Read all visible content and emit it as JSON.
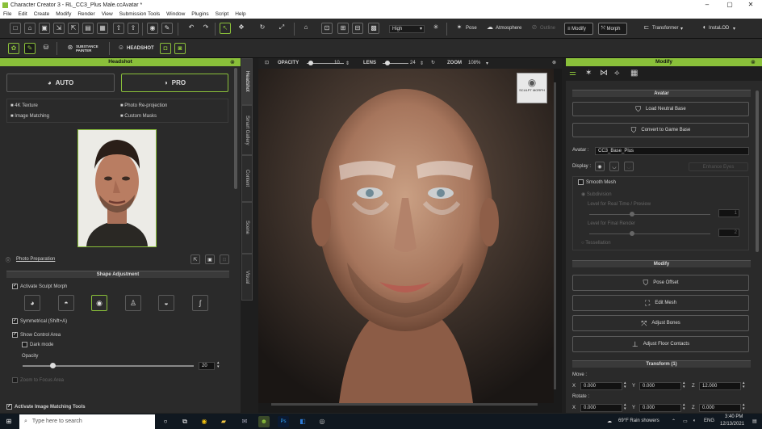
{
  "window": {
    "title": "Character Creator 3 - RL_CC3_Plus Male.ccAvatar *"
  },
  "menu": [
    "File",
    "Edit",
    "Create",
    "Modify",
    "Render",
    "View",
    "Submission Tools",
    "Window",
    "Plugins",
    "Script",
    "Help"
  ],
  "toolbar": {
    "quality_value": "High",
    "pose_label": "Pose",
    "atmosphere_label": "Atmosphere",
    "outline_label": "Outline",
    "modify_label": "Modify",
    "morph_label": "Morph",
    "transformer_label": "Transformer",
    "instalod_label": "InstaLOD",
    "headshot_label": "HEADSHOT",
    "substance_label": "SUBSTANCE PAINTER"
  },
  "headshot": {
    "panel_title": "Headshot",
    "auto_label": "AUTO",
    "pro_label": "PRO",
    "features": [
      "4K Texture",
      "Photo Re-projection",
      "Image Matching",
      "Custom Masks"
    ],
    "photo_preparation_label": "Photo Preparation",
    "shape_adjustment_title": "Shape Adjustment",
    "activate_sculpt_morph": "Activate Sculpt Morph",
    "symmetrical_label": "Symmetrical (Shift+A)",
    "show_control_area": "Show Control Area",
    "dark_mode": "Dark mode",
    "opacity_label": "Opacity",
    "opacity_value": "20",
    "zoom_to_focus_area": "Zoom to Focus Area",
    "activate_image_matching": "Activate Image Matching Tools"
  },
  "side_tabs": [
    "Headshot",
    "Smart Gallery",
    "Content",
    "Scene",
    "Visual"
  ],
  "viewport": {
    "opacity_label": "OPACITY",
    "opacity_value": "10",
    "lens_label": "LENS",
    "lens_value": "24",
    "zoom_label": "ZOOM",
    "zoom_value": "108%",
    "sculpt_morph_label": "SCULPT MORPH"
  },
  "modify": {
    "panel_title": "Modify",
    "avatar_section": "Avatar",
    "load_neutral_base": "Load Neutral Base",
    "convert_to_game_base": "Convert to Game Base",
    "avatar_label": "Avatar :",
    "avatar_value": "CC3_Base_Plus",
    "display_label": "Display :",
    "enhance_eyes": "Enhance Eyes",
    "smooth_mesh": "Smooth Mesh",
    "subdivision": "Subdivision",
    "level_realtime": "Level for Real Time / Preview",
    "level_final": "Level for Final Render",
    "level_realtime_value": "1",
    "level_final_value": "2",
    "tessellation": "Tessellation",
    "modify_section": "Modify",
    "pose_offset": "Pose Offset",
    "edit_mesh": "Edit Mesh",
    "adjust_bones": "Adjust Bones",
    "adjust_floor_contacts": "Adjust Floor Contacts",
    "transform_section": "Transform  (1)",
    "move_label": "Move :",
    "rotate_label": "Rotate :",
    "move": {
      "x": "0.000",
      "y": "0.000",
      "z": "12.000"
    },
    "rotate": {
      "x": "0.000",
      "y": "0.000",
      "z": "0.000"
    }
  },
  "taskbar": {
    "search_placeholder": "Type here to search",
    "weather": "69°F  Rain showers",
    "lang": "ENG",
    "time": "3:40 PM",
    "date": "12/13/2021"
  },
  "colors": {
    "accent": "#8ac03a",
    "panel": "#2a2a2a",
    "header": "#3a3a3a"
  }
}
